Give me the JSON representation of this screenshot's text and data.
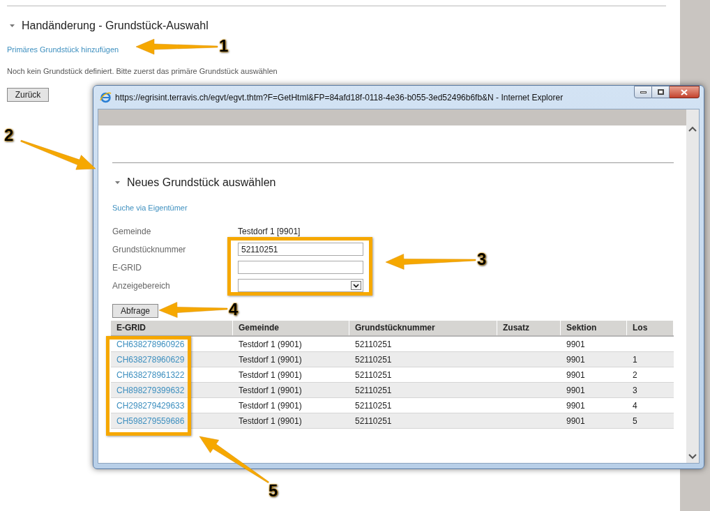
{
  "page": {
    "section_title": "Handänderung - Grundstück-Auswahl",
    "add_link": "Primäres Grundstück hinzufügen",
    "info_text": "Noch kein Grundstück definiert. Bitte zuerst das primäre Grundstück auswählen",
    "back_button": "Zurück"
  },
  "popup": {
    "title": "https://egrisint.terravis.ch/egvt/egvt.thtm?F=GetHtml&FP=84afd18f-0118-4e36-b055-3ed52496b6fb&N - Internet Explorer",
    "section_title": "Neues Grundstück auswählen",
    "search_link": "Suche via Eigentümer",
    "fields": [
      {
        "label": "Gemeinde",
        "kind": "static",
        "value": "Testdorf 1 [9901]"
      },
      {
        "label": "Grundstücknummer",
        "kind": "input",
        "value": "52110251"
      },
      {
        "label": "E-GRID",
        "kind": "input"
      },
      {
        "label": "Anzeigebereich",
        "kind": "select"
      }
    ],
    "query_button": "Abfrage",
    "table": {
      "columns": [
        "E-GRID",
        "Gemeinde",
        "Grundstücknummer",
        "Zusatz",
        "Sektion",
        "Los"
      ],
      "rows": [
        {
          "egrid": "CH638278960926",
          "gemeinde": "Testdorf 1 (9901)",
          "nummer": "52110251",
          "sektion": "9901"
        },
        {
          "egrid": "CH638278960629",
          "gemeinde": "Testdorf 1 (9901)",
          "nummer": "52110251",
          "sektion": "9901",
          "los": "1"
        },
        {
          "egrid": "CH638278961322",
          "gemeinde": "Testdorf 1 (9901)",
          "nummer": "52110251",
          "sektion": "9901",
          "los": "2"
        },
        {
          "egrid": "CH898279399632",
          "gemeinde": "Testdorf 1 (9901)",
          "nummer": "52110251",
          "sektion": "9901",
          "los": "3"
        },
        {
          "egrid": "CH298279429633",
          "gemeinde": "Testdorf 1 (9901)",
          "nummer": "52110251",
          "sektion": "9901",
          "los": "4"
        },
        {
          "egrid": "CH598279559686",
          "gemeinde": "Testdorf 1 (9901)",
          "nummer": "52110251",
          "sektion": "9901",
          "los": "5"
        }
      ]
    }
  },
  "annotations": [
    {
      "label": "1"
    },
    {
      "label": "2"
    },
    {
      "label": "3"
    },
    {
      "label": "4"
    },
    {
      "label": "5"
    }
  ]
}
